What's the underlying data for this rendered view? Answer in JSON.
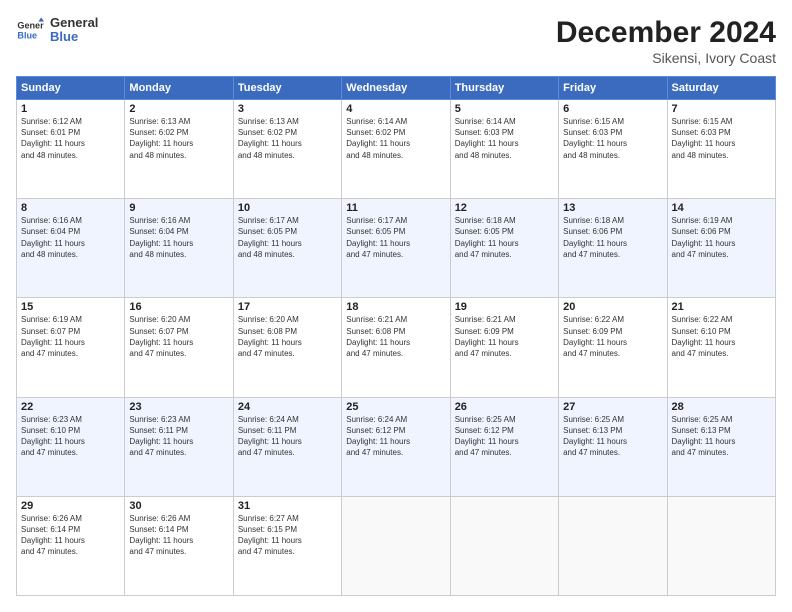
{
  "logo": {
    "line1": "General",
    "line2": "Blue"
  },
  "title": "December 2024",
  "subtitle": "Sikensi, Ivory Coast",
  "days_of_week": [
    "Sunday",
    "Monday",
    "Tuesday",
    "Wednesday",
    "Thursday",
    "Friday",
    "Saturday"
  ],
  "weeks": [
    [
      {
        "day": "1",
        "info": "Sunrise: 6:12 AM\nSunset: 6:01 PM\nDaylight: 11 hours\nand 48 minutes."
      },
      {
        "day": "2",
        "info": "Sunrise: 6:13 AM\nSunset: 6:02 PM\nDaylight: 11 hours\nand 48 minutes."
      },
      {
        "day": "3",
        "info": "Sunrise: 6:13 AM\nSunset: 6:02 PM\nDaylight: 11 hours\nand 48 minutes."
      },
      {
        "day": "4",
        "info": "Sunrise: 6:14 AM\nSunset: 6:02 PM\nDaylight: 11 hours\nand 48 minutes."
      },
      {
        "day": "5",
        "info": "Sunrise: 6:14 AM\nSunset: 6:03 PM\nDaylight: 11 hours\nand 48 minutes."
      },
      {
        "day": "6",
        "info": "Sunrise: 6:15 AM\nSunset: 6:03 PM\nDaylight: 11 hours\nand 48 minutes."
      },
      {
        "day": "7",
        "info": "Sunrise: 6:15 AM\nSunset: 6:03 PM\nDaylight: 11 hours\nand 48 minutes."
      }
    ],
    [
      {
        "day": "8",
        "info": "Sunrise: 6:16 AM\nSunset: 6:04 PM\nDaylight: 11 hours\nand 48 minutes."
      },
      {
        "day": "9",
        "info": "Sunrise: 6:16 AM\nSunset: 6:04 PM\nDaylight: 11 hours\nand 48 minutes."
      },
      {
        "day": "10",
        "info": "Sunrise: 6:17 AM\nSunset: 6:05 PM\nDaylight: 11 hours\nand 48 minutes."
      },
      {
        "day": "11",
        "info": "Sunrise: 6:17 AM\nSunset: 6:05 PM\nDaylight: 11 hours\nand 47 minutes."
      },
      {
        "day": "12",
        "info": "Sunrise: 6:18 AM\nSunset: 6:05 PM\nDaylight: 11 hours\nand 47 minutes."
      },
      {
        "day": "13",
        "info": "Sunrise: 6:18 AM\nSunset: 6:06 PM\nDaylight: 11 hours\nand 47 minutes."
      },
      {
        "day": "14",
        "info": "Sunrise: 6:19 AM\nSunset: 6:06 PM\nDaylight: 11 hours\nand 47 minutes."
      }
    ],
    [
      {
        "day": "15",
        "info": "Sunrise: 6:19 AM\nSunset: 6:07 PM\nDaylight: 11 hours\nand 47 minutes."
      },
      {
        "day": "16",
        "info": "Sunrise: 6:20 AM\nSunset: 6:07 PM\nDaylight: 11 hours\nand 47 minutes."
      },
      {
        "day": "17",
        "info": "Sunrise: 6:20 AM\nSunset: 6:08 PM\nDaylight: 11 hours\nand 47 minutes."
      },
      {
        "day": "18",
        "info": "Sunrise: 6:21 AM\nSunset: 6:08 PM\nDaylight: 11 hours\nand 47 minutes."
      },
      {
        "day": "19",
        "info": "Sunrise: 6:21 AM\nSunset: 6:09 PM\nDaylight: 11 hours\nand 47 minutes."
      },
      {
        "day": "20",
        "info": "Sunrise: 6:22 AM\nSunset: 6:09 PM\nDaylight: 11 hours\nand 47 minutes."
      },
      {
        "day": "21",
        "info": "Sunrise: 6:22 AM\nSunset: 6:10 PM\nDaylight: 11 hours\nand 47 minutes."
      }
    ],
    [
      {
        "day": "22",
        "info": "Sunrise: 6:23 AM\nSunset: 6:10 PM\nDaylight: 11 hours\nand 47 minutes."
      },
      {
        "day": "23",
        "info": "Sunrise: 6:23 AM\nSunset: 6:11 PM\nDaylight: 11 hours\nand 47 minutes."
      },
      {
        "day": "24",
        "info": "Sunrise: 6:24 AM\nSunset: 6:11 PM\nDaylight: 11 hours\nand 47 minutes."
      },
      {
        "day": "25",
        "info": "Sunrise: 6:24 AM\nSunset: 6:12 PM\nDaylight: 11 hours\nand 47 minutes."
      },
      {
        "day": "26",
        "info": "Sunrise: 6:25 AM\nSunset: 6:12 PM\nDaylight: 11 hours\nand 47 minutes."
      },
      {
        "day": "27",
        "info": "Sunrise: 6:25 AM\nSunset: 6:13 PM\nDaylight: 11 hours\nand 47 minutes."
      },
      {
        "day": "28",
        "info": "Sunrise: 6:25 AM\nSunset: 6:13 PM\nDaylight: 11 hours\nand 47 minutes."
      }
    ],
    [
      {
        "day": "29",
        "info": "Sunrise: 6:26 AM\nSunset: 6:14 PM\nDaylight: 11 hours\nand 47 minutes."
      },
      {
        "day": "30",
        "info": "Sunrise: 6:26 AM\nSunset: 6:14 PM\nDaylight: 11 hours\nand 47 minutes."
      },
      {
        "day": "31",
        "info": "Sunrise: 6:27 AM\nSunset: 6:15 PM\nDaylight: 11 hours\nand 47 minutes."
      },
      {
        "day": "",
        "info": ""
      },
      {
        "day": "",
        "info": ""
      },
      {
        "day": "",
        "info": ""
      },
      {
        "day": "",
        "info": ""
      }
    ]
  ]
}
